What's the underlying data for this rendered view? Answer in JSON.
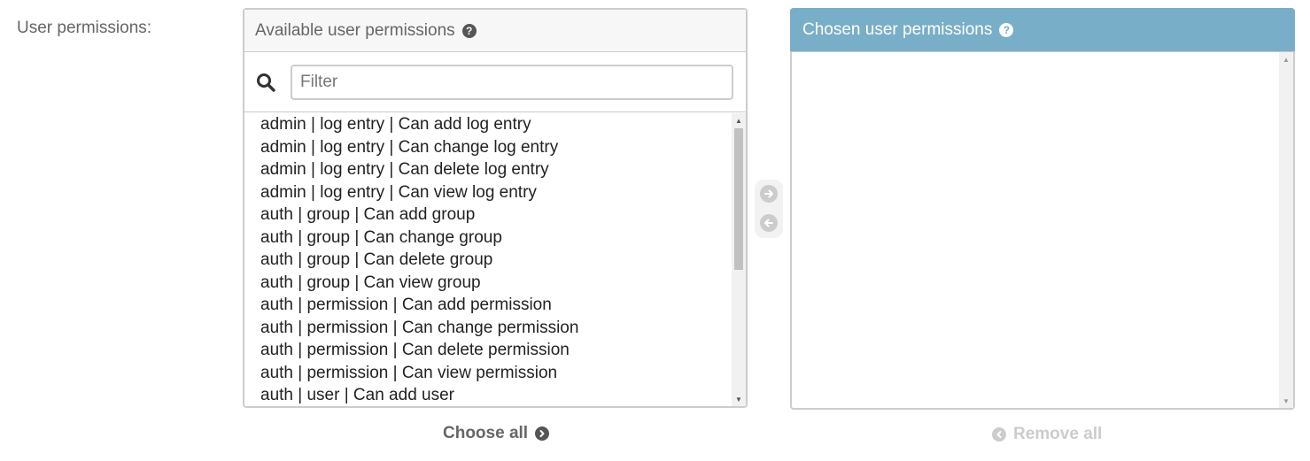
{
  "field": {
    "label": "User permissions:"
  },
  "available": {
    "title": "Available user permissions",
    "help_icon": "question-circle-icon",
    "filter_placeholder": "Filter",
    "filter_value": "",
    "search_icon": "search-icon",
    "options": [
      "admin | log entry | Can add log entry",
      "admin | log entry | Can change log entry",
      "admin | log entry | Can delete log entry",
      "admin | log entry | Can view log entry",
      "auth | group | Can add group",
      "auth | group | Can change group",
      "auth | group | Can delete group",
      "auth | group | Can view group",
      "auth | permission | Can add permission",
      "auth | permission | Can change permission",
      "auth | permission | Can delete permission",
      "auth | permission | Can view permission",
      "auth | user | Can add user"
    ],
    "choose_all_label": "Choose all"
  },
  "chooser": {
    "add_icon": "arrow-right-circle-icon",
    "remove_icon": "arrow-left-circle-icon"
  },
  "chosen": {
    "title": "Chosen user permissions",
    "help_icon": "question-circle-icon",
    "options": [],
    "remove_all_label": "Remove all"
  },
  "colors": {
    "chosen_header_bg": "#79aec8",
    "available_header_bg": "#f7f7f7",
    "border": "#cccccc",
    "disabled": "#cccccc"
  }
}
